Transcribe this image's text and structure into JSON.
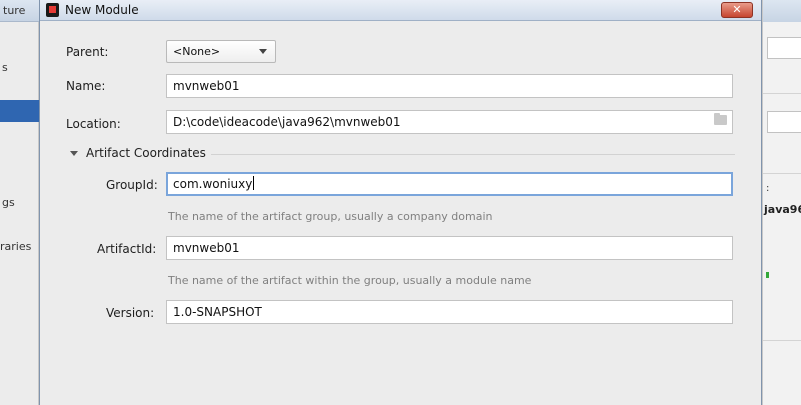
{
  "background": {
    "left_title": "ture",
    "left_items": [
      "s",
      "gs",
      "raries"
    ],
    "right_labels": [
      "java96"
    ]
  },
  "dialog": {
    "title": "New Module",
    "close_glyph": "✕",
    "parent": {
      "label": "Parent:",
      "value": "<None>"
    },
    "name": {
      "label": "Name:",
      "value": "mvnweb01"
    },
    "location": {
      "label": "Location:",
      "value": "D:\\code\\ideacode\\java962\\mvnweb01",
      "browse_icon": "folder-icon"
    },
    "section": {
      "title": "Artifact Coordinates",
      "icon": "triangle-down-icon"
    },
    "group_id": {
      "label": "GroupId:",
      "value": "com.woniuxy",
      "hint": "The name of the artifact group, usually a company domain"
    },
    "artifact_id": {
      "label": "ArtifactId:",
      "value": "mvnweb01",
      "hint": "The name of the artifact within the group, usually a module name"
    },
    "version": {
      "label": "Version:",
      "value": "1.0-SNAPSHOT"
    }
  },
  "colors": {
    "dialog_bg": "#ececec",
    "focus_border": "#7aa5db",
    "close_button": "#c6452f",
    "selection": "#2f66b1",
    "hint_text": "#808080"
  }
}
